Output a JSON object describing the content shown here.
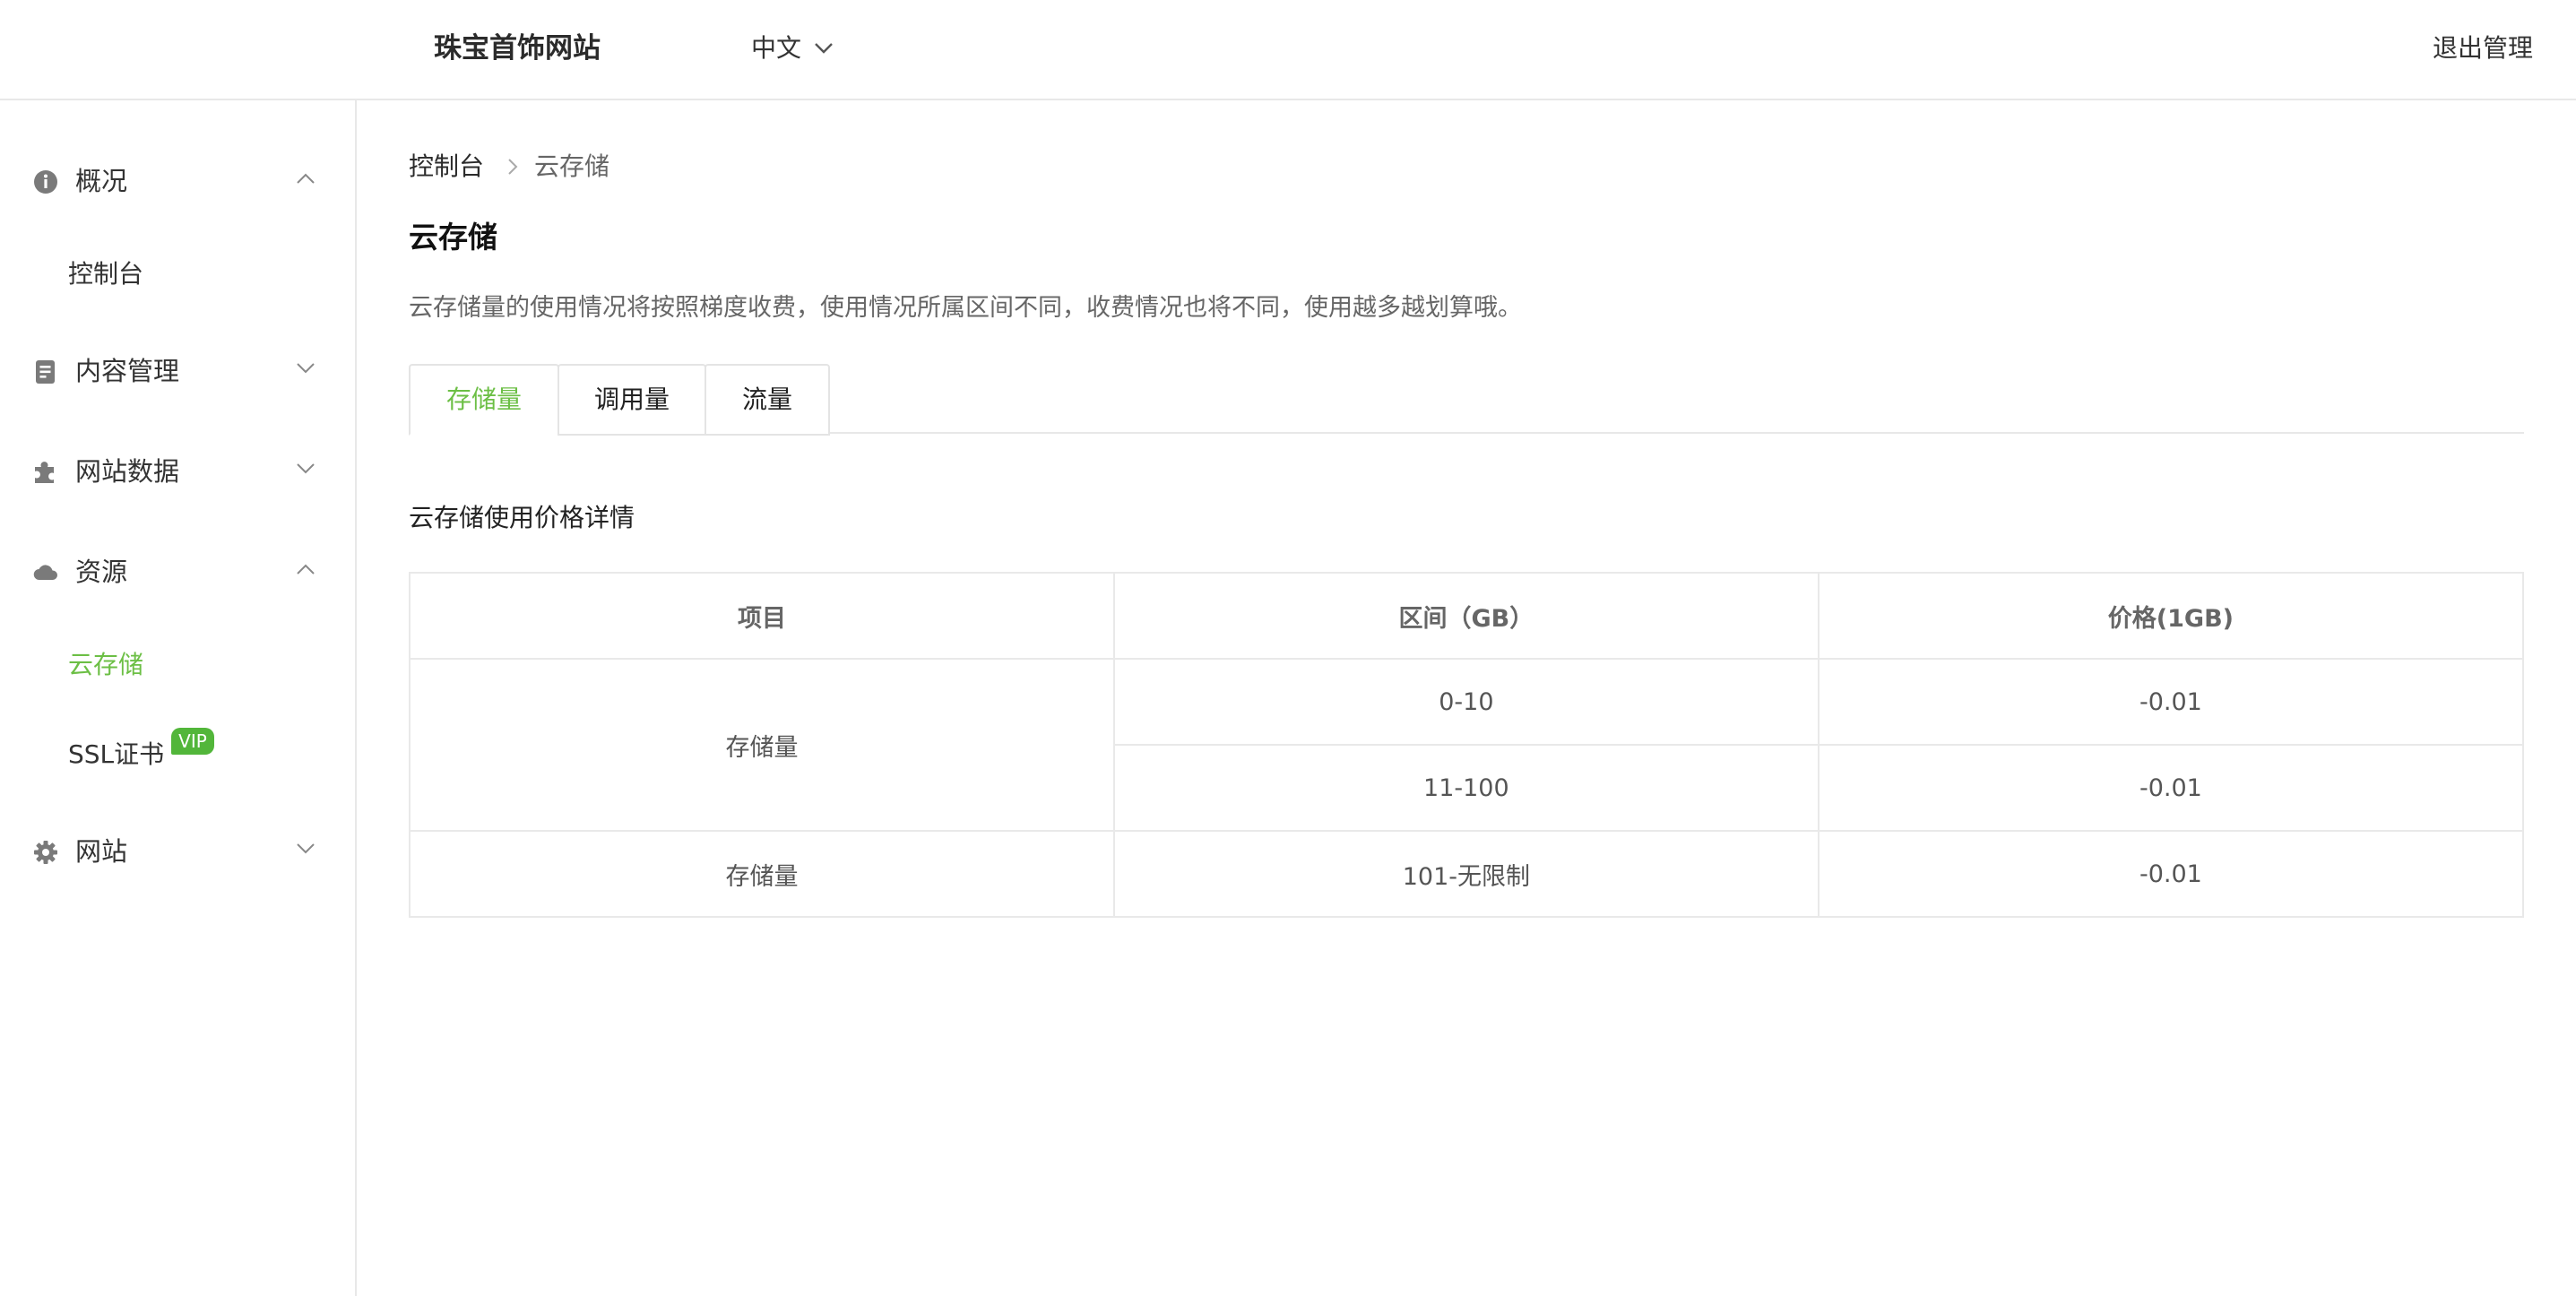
{
  "header": {
    "site_title": "珠宝首饰网站",
    "language": "中文",
    "logout": "退出管理"
  },
  "sidebar": {
    "groups": [
      {
        "label": "概况",
        "icon": "info-icon",
        "expanded": true,
        "items": [
          "控制台"
        ]
      },
      {
        "label": "内容管理",
        "icon": "document-icon",
        "expanded": false,
        "items": []
      },
      {
        "label": "网站数据",
        "icon": "puzzle-icon",
        "expanded": false,
        "items": []
      },
      {
        "label": "资源",
        "icon": "cloud-icon",
        "expanded": true,
        "items": [
          "云存储",
          "SSL证书"
        ]
      },
      {
        "label": "网站",
        "icon": "gear-icon",
        "expanded": false,
        "items": []
      }
    ],
    "active_item": "云存储",
    "vip_badge": "VIP",
    "accent_color": "#6cbf45"
  },
  "breadcrumb": {
    "root": "控制台",
    "current": "云存储"
  },
  "page": {
    "title": "云存储",
    "description": "云存储量的使用情况将按照梯度收费，使用情况所属区间不同，收费情况也将不同，使用越多越划算哦。",
    "tabs": [
      "存储量",
      "调用量",
      "流量"
    ],
    "active_tab": "存储量",
    "section_title": "云存储使用价格详情"
  },
  "table": {
    "headers": [
      "项目",
      "区间（GB）",
      "价格(1GB)"
    ],
    "rows": [
      {
        "item": "存储量",
        "ranges": [
          {
            "range": "0-10",
            "price": "-0.01"
          },
          {
            "range": "11-100",
            "price": "-0.01"
          }
        ]
      },
      {
        "item": "存储量",
        "ranges": [
          {
            "range": "101-无限制",
            "price": "-0.01"
          }
        ]
      }
    ]
  }
}
